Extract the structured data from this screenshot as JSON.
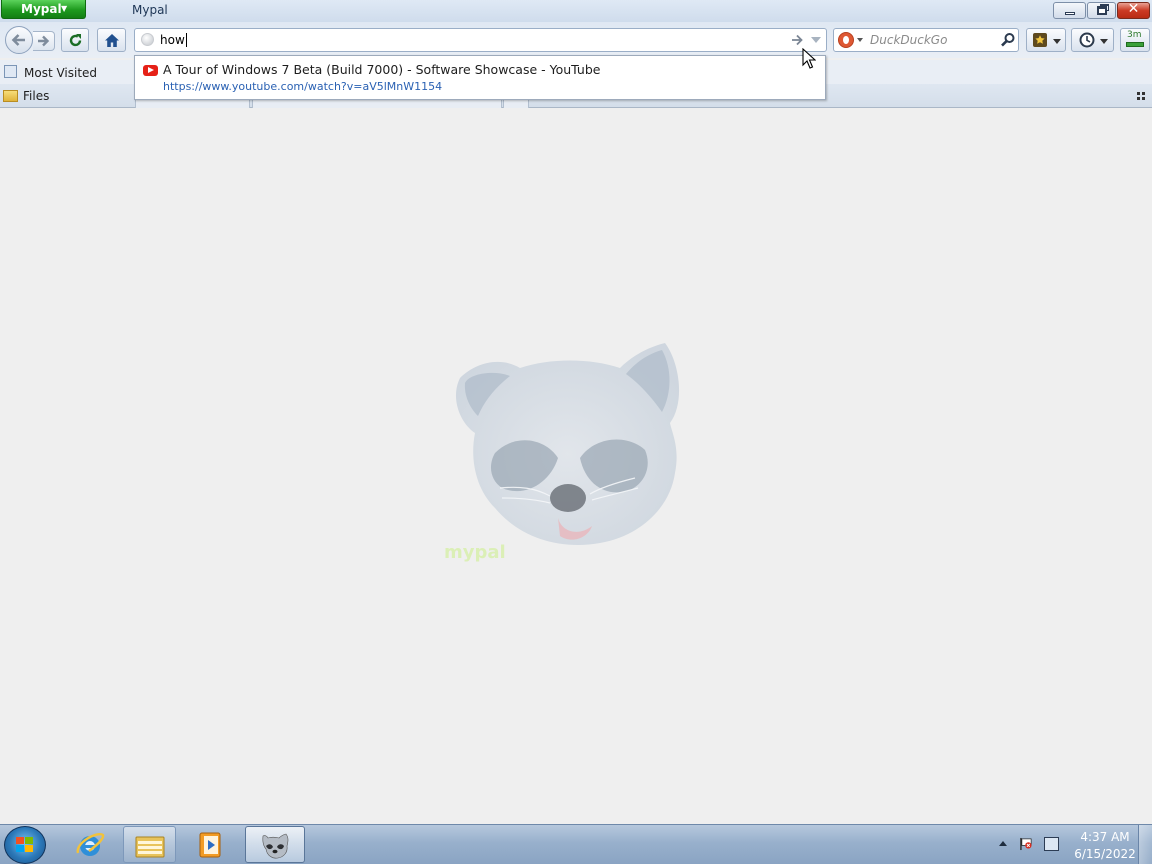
{
  "window": {
    "app_menu_label": "Mypal",
    "title": "Mypal",
    "buttons": {
      "minimize": "minimize",
      "maximize": "restore",
      "close": "close"
    }
  },
  "navbar": {
    "url_value": "how",
    "search_placeholder": "DuckDuckGo",
    "search_engine": "DuckDuckGo",
    "addon_label": "3m"
  },
  "bookmarks_toolbar": {
    "items": [
      {
        "label": "Most Visited",
        "icon": "most-visited-icon"
      }
    ]
  },
  "tabstrip": {
    "items": [
      {
        "label": "Files",
        "icon": "folder-icon"
      }
    ]
  },
  "autocomplete": {
    "results": [
      {
        "title": "A Tour of Windows 7 Beta (Build 7000) - Software Showcase - YouTube",
        "url": "https://www.youtube.com/watch?v=aV5lMnW1154",
        "icon": "youtube-icon"
      }
    ]
  },
  "content": {
    "image": "raccoon-logo",
    "watermark_text": "mypal"
  },
  "taskbar": {
    "items": [
      {
        "name": "internet-explorer",
        "icon": "ie-icon"
      },
      {
        "name": "windows-explorer",
        "icon": "folder-icon"
      },
      {
        "name": "media-player",
        "icon": "media-player-icon"
      },
      {
        "name": "mypal",
        "icon": "raccoon-icon",
        "active": true
      }
    ],
    "clock_time": "4:37 AM",
    "clock_date": "6/15/2022"
  },
  "colors": {
    "app_menu": "#1e9a1e",
    "close_button": "#cb3a24",
    "link": "#2a61b3",
    "taskbar": "#98b0cc",
    "content_bg": "#efefef"
  }
}
